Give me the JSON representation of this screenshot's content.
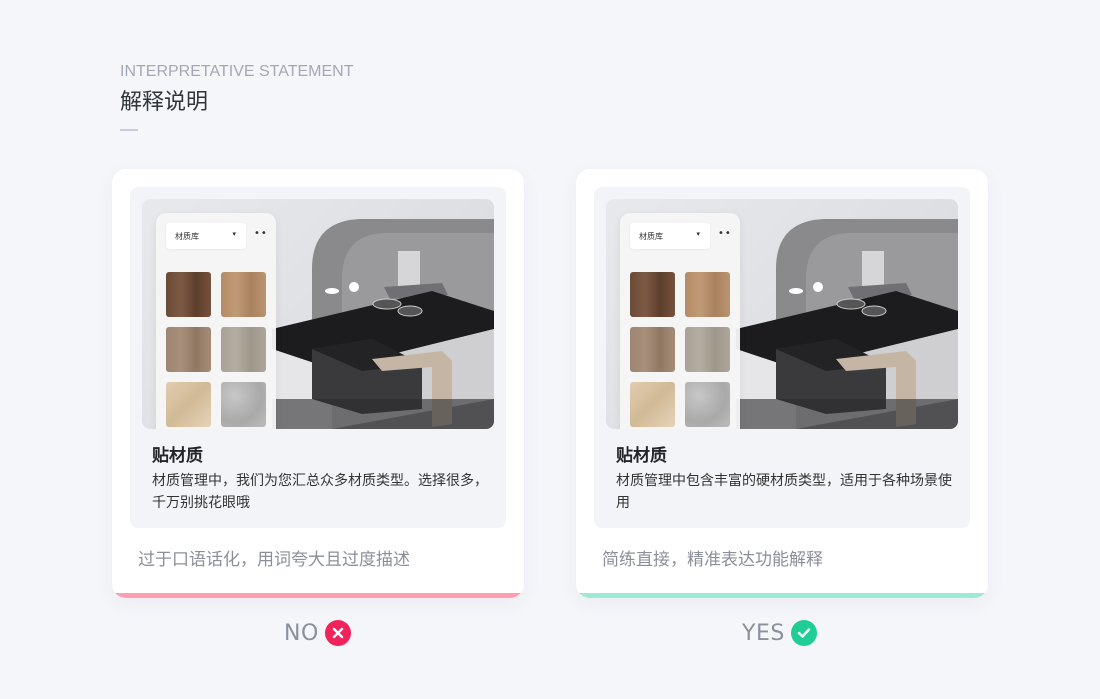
{
  "header": {
    "eyebrow": "INTERPRETATIVE STATEMENT",
    "title": "解释说明"
  },
  "screenshot_ui": {
    "dropdown_label": "材质库",
    "dropdown_arrow": "▾",
    "more": "••"
  },
  "cards": [
    {
      "verdict": "NO",
      "verdict_icon": "close-icon",
      "accent": "#ff9db4",
      "badge_color": "#f0235c",
      "inner_title": "贴材质",
      "inner_desc": "材质管理中，我们为您汇总众多材质类型。选择很多，千万别挑花眼哦",
      "caption": "过于口语话化，用词夸大且过度描述"
    },
    {
      "verdict": "YES",
      "verdict_icon": "check-icon",
      "accent": "#9ee9d4",
      "badge_color": "#1fcd95",
      "inner_title": "贴材质",
      "inner_desc": "材质管理中包含丰富的硬材质类型，适用于各种场景使用",
      "caption": "简练直接，精准表达功能解释"
    }
  ]
}
